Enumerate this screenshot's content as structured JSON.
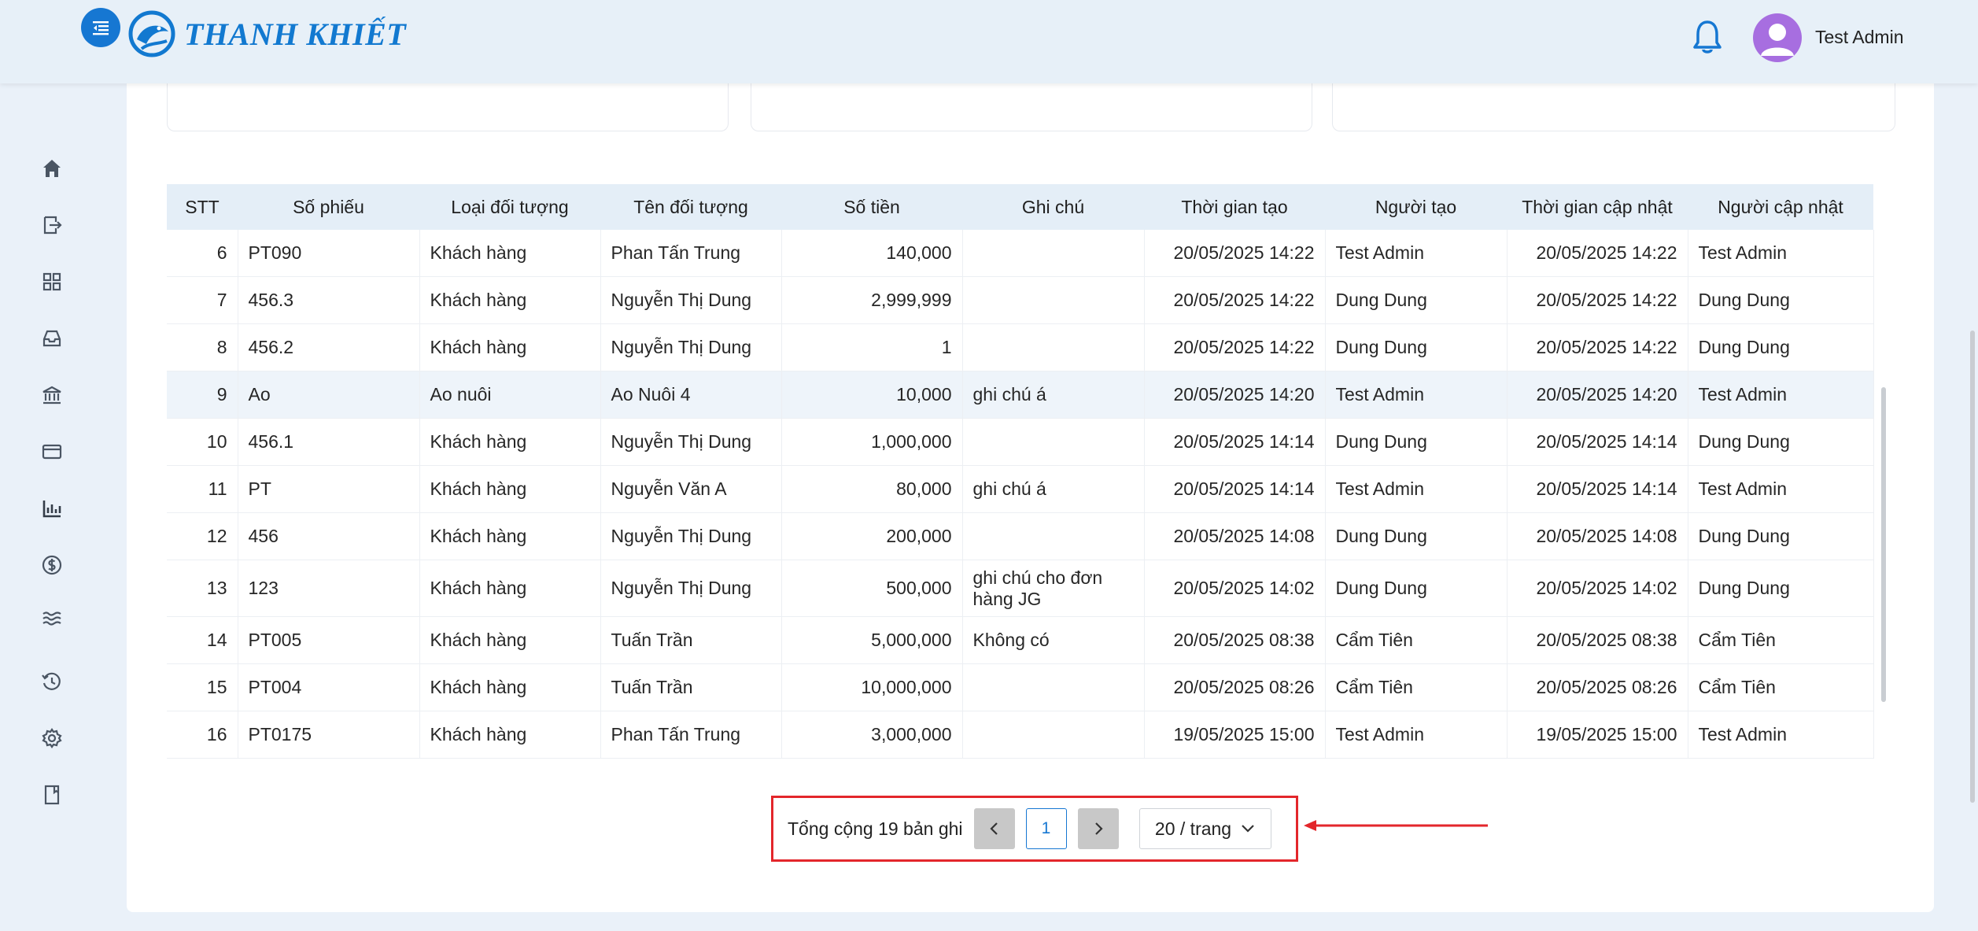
{
  "brand": {
    "name": "THANH KHIẾT"
  },
  "header": {
    "user_name": "Test Admin"
  },
  "sidebar": {
    "icons": [
      "home-icon",
      "export-icon",
      "grid-icon",
      "inbox-icon",
      "bank-icon",
      "card-icon",
      "bar-chart-icon",
      "dollar-icon",
      "waves-icon",
      "history-icon",
      "settings-icon",
      "book-icon"
    ]
  },
  "table": {
    "columns": [
      "STT",
      "Số phiếu",
      "Loại đối tượng",
      "Tên đối tượng",
      "Số tiền",
      "Ghi chú",
      "Thời gian tạo",
      "Người tạo",
      "Thời gian cập nhật",
      "Người cập nhật"
    ],
    "rows": [
      [
        "6",
        "PT090",
        "Khách hàng",
        "Phan Tấn Trung",
        "140,000",
        "",
        "20/05/2025 14:22",
        "Test Admin",
        "20/05/2025 14:22",
        "Test Admin"
      ],
      [
        "7",
        "456.3",
        "Khách hàng",
        "Nguyễn Thị Dung",
        "2,999,999",
        "",
        "20/05/2025 14:22",
        "Dung Dung",
        "20/05/2025 14:22",
        "Dung Dung"
      ],
      [
        "8",
        "456.2",
        "Khách hàng",
        "Nguyễn Thị Dung",
        "1",
        "",
        "20/05/2025 14:22",
        "Dung Dung",
        "20/05/2025 14:22",
        "Dung Dung"
      ],
      [
        "9",
        "Ao",
        "Ao nuôi",
        "Ao Nuôi 4",
        "10,000",
        "ghi chú á",
        "20/05/2025 14:20",
        "Test Admin",
        "20/05/2025 14:20",
        "Test Admin"
      ],
      [
        "10",
        "456.1",
        "Khách hàng",
        "Nguyễn Thị Dung",
        "1,000,000",
        "",
        "20/05/2025 14:14",
        "Dung Dung",
        "20/05/2025 14:14",
        "Dung Dung"
      ],
      [
        "11",
        "PT",
        "Khách hàng",
        "Nguyễn Văn A",
        "80,000",
        "ghi chú á",
        "20/05/2025 14:14",
        "Test Admin",
        "20/05/2025 14:14",
        "Test Admin"
      ],
      [
        "12",
        "456",
        "Khách hàng",
        "Nguyễn Thị Dung",
        "200,000",
        "",
        "20/05/2025 14:08",
        "Dung Dung",
        "20/05/2025 14:08",
        "Dung Dung"
      ],
      [
        "13",
        "123",
        "Khách hàng",
        "Nguyễn Thị Dung",
        "500,000",
        "ghi chú cho đơn hàng JG",
        "20/05/2025 14:02",
        "Dung Dung",
        "20/05/2025 14:02",
        "Dung Dung"
      ],
      [
        "14",
        "PT005",
        "Khách hàng",
        "Tuấn Trần",
        "5,000,000",
        "Không có",
        "20/05/2025 08:38",
        "Cẩm Tiên",
        "20/05/2025 08:38",
        "Cẩm Tiên"
      ],
      [
        "15",
        "PT004",
        "Khách hàng",
        "Tuấn Trần",
        "10,000,000",
        "",
        "20/05/2025 08:26",
        "Cẩm Tiên",
        "20/05/2025 08:26",
        "Cẩm Tiên"
      ],
      [
        "16",
        "PT0175",
        "Khách hàng",
        "Phan Tấn Trung",
        "3,000,000",
        "",
        "19/05/2025 15:00",
        "Test Admin",
        "19/05/2025 15:00",
        "Test Admin"
      ]
    ],
    "highlighted_row": "9"
  },
  "pagination": {
    "total_label": "Tổng cộng 19 bản ghi",
    "current_page": "1",
    "page_size_label": "20 / trang"
  },
  "colors": {
    "accent": "#1677d2",
    "highlight_box": "#e3262b",
    "header_bg": "#e4eef7"
  }
}
